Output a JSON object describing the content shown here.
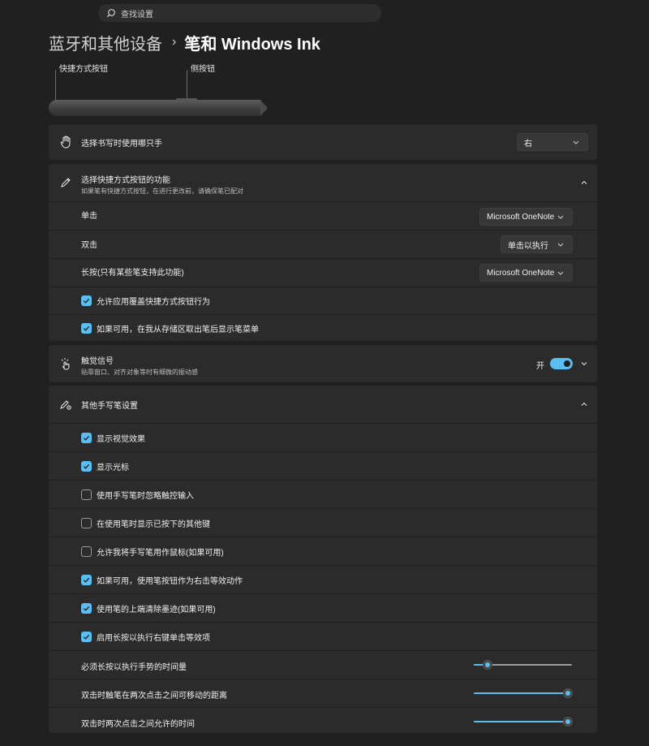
{
  "search": {
    "placeholder": "查找设置"
  },
  "breadcrumb": {
    "parent": "蓝牙和其他设备",
    "separator": "›",
    "current": "笔和 Windows Ink"
  },
  "pen": {
    "shortcut_label": "快捷方式按钮",
    "side_label": "侧按钮"
  },
  "handedness": {
    "label": "选择书写时使用哪只手",
    "value": "右"
  },
  "shortcut": {
    "title": "选择快捷方式按钮的功能",
    "desc": "如果笔有快捷方式按钮，在进行更改前，请确保笔已配对",
    "single_label": "单击",
    "single_value": "Microsoft OneNote",
    "double_label": "双击",
    "double_value": "单击以执行",
    "long_label": "长按(只有某些笔支持此功能)",
    "long_value": "Microsoft OneNote",
    "allow_override": {
      "label": "允许应用覆盖快捷方式按钮行为",
      "checked": true
    },
    "show_menu": {
      "label": "如果可用，在我从存储区取出笔后显示笔菜单",
      "checked": true
    }
  },
  "haptics": {
    "title": "触觉信号",
    "desc": "贴靠窗口、对齐对象等时有细微的振动感",
    "toggle_label": "开",
    "on": true
  },
  "other": {
    "title": "其他手写笔设置",
    "options": [
      {
        "label": "显示视觉效果",
        "checked": true
      },
      {
        "label": "显示光标",
        "checked": true
      },
      {
        "label": "使用手写笔时忽略触控输入",
        "checked": false
      },
      {
        "label": "在使用笔时显示已按下的其他键",
        "checked": false
      },
      {
        "label": "允许我将手写笔用作鼠标(如果可用)",
        "checked": false
      },
      {
        "label": "如果可用，使用笔按钮作为右击等效动作",
        "checked": true
      },
      {
        "label": "使用笔的上端清除墨迹(如果可用)",
        "checked": true
      },
      {
        "label": "启用长按以执行右键单击等效项",
        "checked": true
      }
    ],
    "sliders": [
      {
        "label": "必须长按以执行手势的时间量",
        "value": 0.14
      },
      {
        "label": "双击时触笔在两次点击之间可移动的距离",
        "value": 0.96
      },
      {
        "label": "双击时两次点击之间允许的时间",
        "value": 0.96
      }
    ]
  },
  "colors": {
    "accent": "#5bbdf0",
    "card": "#2b2b2b",
    "background": "#202020"
  }
}
